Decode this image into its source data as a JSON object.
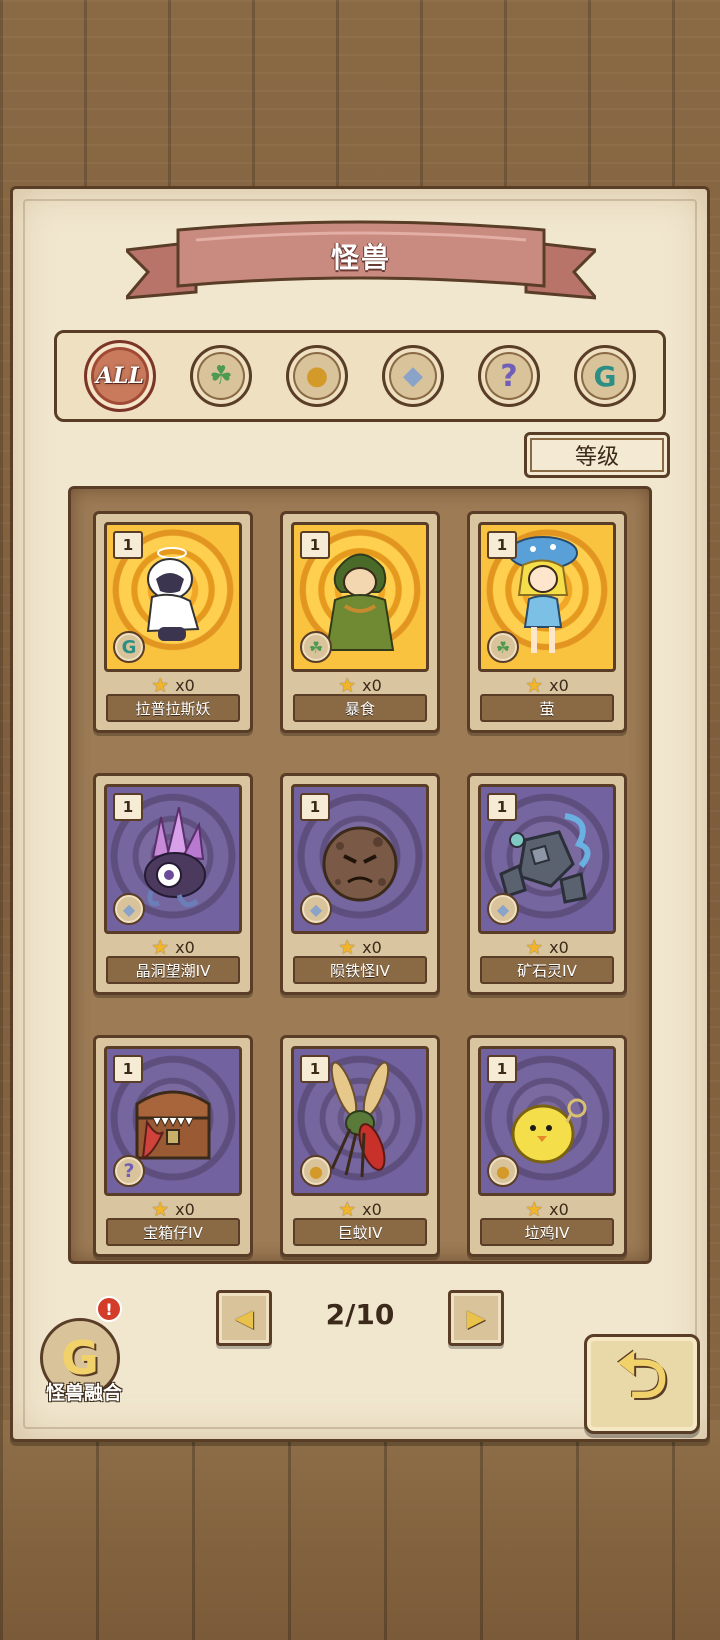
{
  "title": "怪兽",
  "filters": [
    {
      "id": "all",
      "label": "ALL",
      "icon": "all-text-icon",
      "active": true
    },
    {
      "id": "plant",
      "label": "",
      "icon": "leaf-icon",
      "active": false
    },
    {
      "id": "beast",
      "label": "",
      "icon": "paw-icon",
      "active": false
    },
    {
      "id": "crystal",
      "label": "",
      "icon": "crystal-icon",
      "active": false
    },
    {
      "id": "unknown",
      "label": "",
      "icon": "question-icon",
      "active": false
    },
    {
      "id": "special",
      "label": "",
      "icon": "g-swirl-icon",
      "active": false
    }
  ],
  "sort_label": "等级",
  "cards": [
    {
      "level": "1",
      "count": "x0",
      "name": "拉普拉斯妖",
      "bg": "gold",
      "type_icon": "g-swirl-icon"
    },
    {
      "level": "1",
      "count": "x0",
      "name": "暴食",
      "bg": "gold",
      "type_icon": "leaf-icon"
    },
    {
      "level": "1",
      "count": "x0",
      "name": "萤",
      "bg": "gold",
      "type_icon": "leaf-icon"
    },
    {
      "level": "1",
      "count": "x0",
      "name": "晶洞望潮IV",
      "bg": "purple",
      "type_icon": "crystal-icon"
    },
    {
      "level": "1",
      "count": "x0",
      "name": "陨铁怪IV",
      "bg": "purple",
      "type_icon": "crystal-icon"
    },
    {
      "level": "1",
      "count": "x0",
      "name": "矿石灵IV",
      "bg": "purple",
      "type_icon": "crystal-icon"
    },
    {
      "level": "1",
      "count": "x0",
      "name": "宝箱仔IV",
      "bg": "purple",
      "type_icon": "question-icon"
    },
    {
      "level": "1",
      "count": "x0",
      "name": "巨蚊IV",
      "bg": "purple",
      "type_icon": "paw-icon"
    },
    {
      "level": "1",
      "count": "x0",
      "name": "垃鸡IV",
      "bg": "purple",
      "type_icon": "paw-icon"
    }
  ],
  "pager": {
    "current": 2,
    "total": 10,
    "label": "2/10"
  },
  "fusion": {
    "label": "怪兽融合",
    "alert": "!"
  },
  "colors": {
    "wood": "#7d5d3b",
    "parchment": "#f1e7cf",
    "ribbon": "#c98a80",
    "outline": "#5a3d27",
    "star": "#f2b52a"
  }
}
